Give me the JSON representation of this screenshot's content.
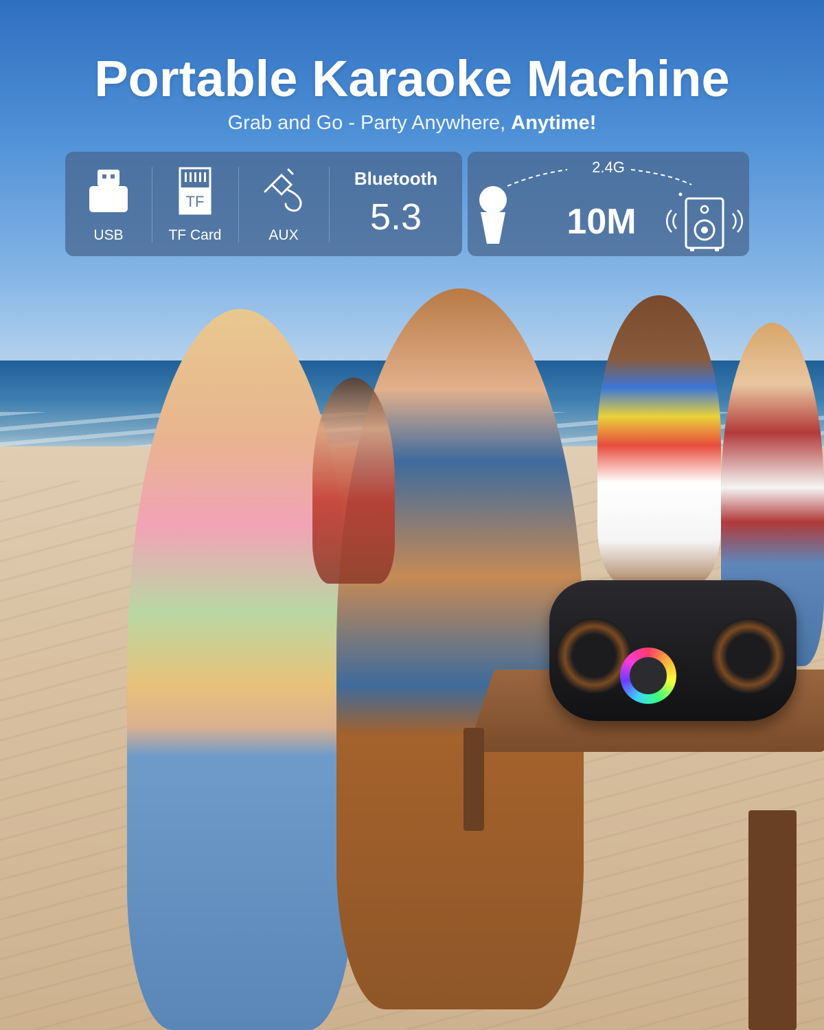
{
  "header": {
    "title": "Portable Karaoke Machine",
    "subtitle_part1": "Grab and Go - Party Anywhere, ",
    "subtitle_part2": "Anytime!"
  },
  "features": {
    "usb": {
      "label": "USB",
      "icon": "usb-drive-icon"
    },
    "tf": {
      "label": "TF Card",
      "icon": "tf-card-icon",
      "icon_text": "TF"
    },
    "aux": {
      "label": "AUX",
      "icon": "aux-cable-icon"
    },
    "bluetooth": {
      "title": "Bluetooth",
      "version": "5.3"
    }
  },
  "wireless": {
    "frequency": "2.4G",
    "range": "10M",
    "mic_icon": "microphone-icon",
    "speaker_icon": "speaker-icon"
  },
  "colors": {
    "panel": "#46648c",
    "text": "#ffffff",
    "sky": "#4d8fd6",
    "sand": "#d8c0a0"
  }
}
